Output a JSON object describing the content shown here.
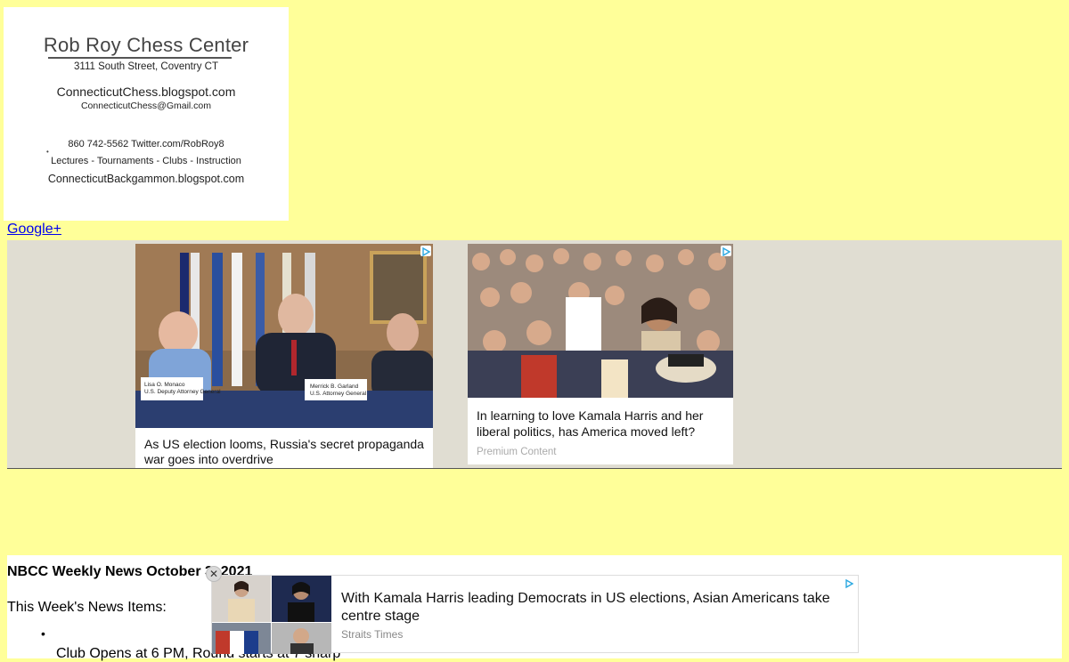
{
  "logo": {
    "title": "Rob Roy Chess Center",
    "address": "3111 South Street, Coventry CT",
    "blog": "ConnecticutChess.blogspot.com",
    "email": "ConnecticutChess@Gmail.com",
    "contact": "860 742-5562 Twitter.com/RobRoy8",
    "services": "Lectures - Tournaments - Clubs - Instruction",
    "backgammon": "ConnecticutBackgammon.blogspot.com"
  },
  "gplus_link": "Google+",
  "ads": [
    {
      "caption": "As US election looms, Russia's secret propaganda war goes into overdrive",
      "image_icon": "press-conference-photo-icon",
      "nameplates": [
        "Lisa O. Monaco",
        "U.S. Deputy Attorney General",
        "Merrick B. Garland",
        "U.S. Attorney General"
      ]
    },
    {
      "caption": "In learning to love Kamala Harris and her liberal politics, has America moved left?",
      "source": "Premium Content",
      "image_icon": "crowd-photo-icon"
    }
  ],
  "post": {
    "title": "NBCC Weekly News October 3, 2021",
    "subtitle": "This Week's News Items:",
    "bullet": "•",
    "first_item": "Club Opens at 6 PM, Round starts at 7 sharp"
  },
  "floating_ad": {
    "headline": "With Kamala Harris leading Democrats in US elections, Asian Americans take centre stage",
    "source": "Straits Times",
    "close_symbol": "✕"
  },
  "colors": {
    "page_bg": "#ffff99",
    "ad_strip_bg": "#e0ddd2",
    "link": "#0000ee",
    "adchoice": "#2aa7e0"
  }
}
